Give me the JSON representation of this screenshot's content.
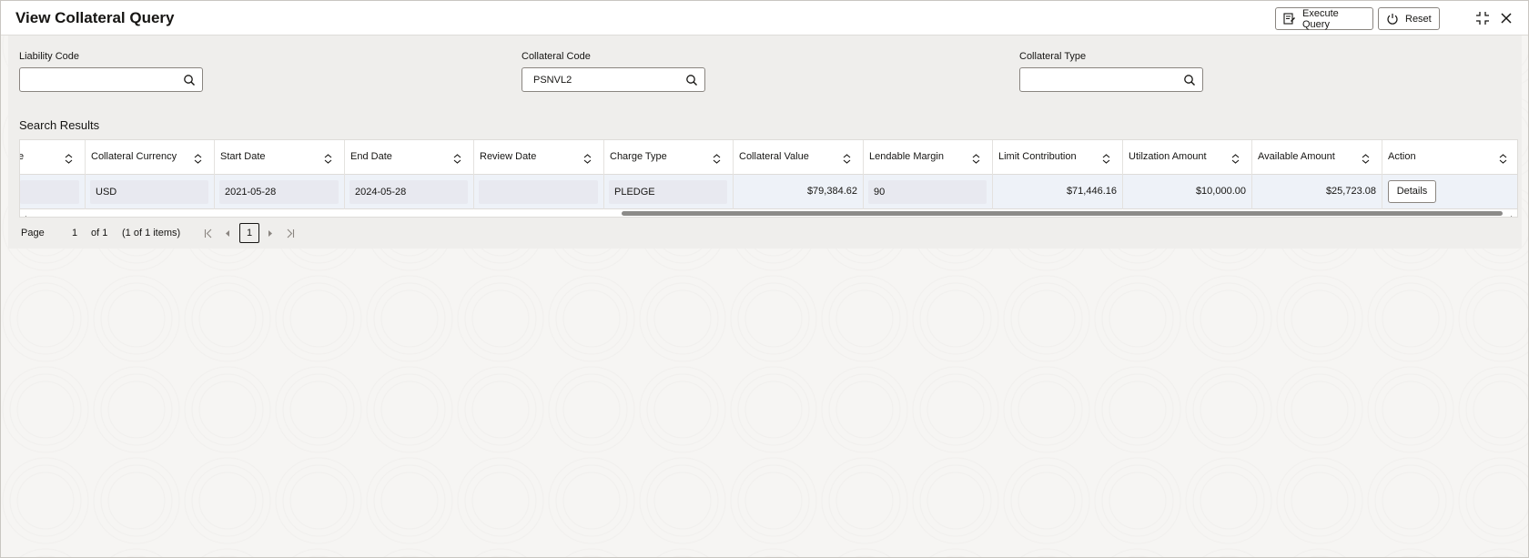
{
  "header": {
    "title": "View Collateral Query",
    "execute_label": "Execute Query",
    "reset_label": "Reset"
  },
  "filters": [
    {
      "label": "Liability Code",
      "value": "",
      "icon": "search-icon"
    },
    {
      "label": "Collateral Code",
      "value": "PSNVL2",
      "icon": "search-icon"
    },
    {
      "label": "Collateral Type",
      "value": "",
      "icon": "search-icon"
    }
  ],
  "results": {
    "title": "Search Results",
    "columns": [
      {
        "label": "e"
      },
      {
        "label": "Collateral Currency"
      },
      {
        "label": "Start Date"
      },
      {
        "label": "End Date"
      },
      {
        "label": "Review Date"
      },
      {
        "label": "Charge Type"
      },
      {
        "label": "Collateral Value"
      },
      {
        "label": "Lendable Margin"
      },
      {
        "label": "Limit Contribution"
      },
      {
        "label": "Utilzation Amount"
      },
      {
        "label": "Available Amount"
      },
      {
        "label": "Action"
      }
    ],
    "row": {
      "partial": "",
      "currency": "USD",
      "start_date": "2021-05-28",
      "end_date": "2024-05-28",
      "review_date": "",
      "charge_type": "PLEDGE",
      "collateral_value": "$79,384.62",
      "lendable_margin": "90",
      "limit_contribution": "$71,446.16",
      "utilization_amount": "$10,000.00",
      "available_amount": "$25,723.08",
      "action_label": "Details"
    }
  },
  "pager": {
    "page_label": "Page",
    "page_value": "1",
    "of_label": "of 1",
    "items_label": "(1 of 1 items)",
    "current_page": "1"
  }
}
